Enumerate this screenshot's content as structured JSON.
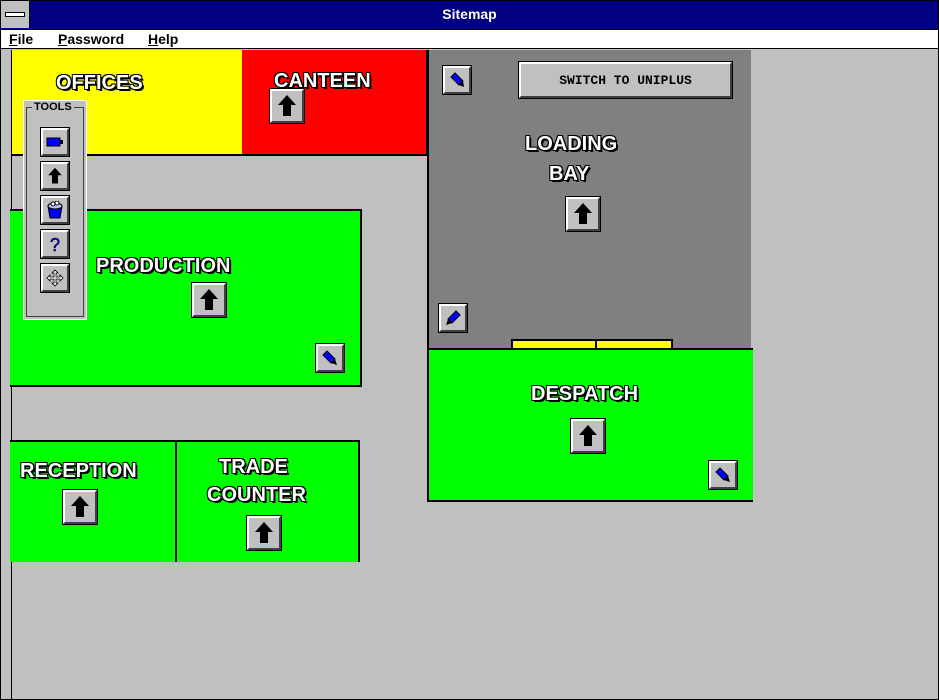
{
  "window": {
    "title": "Sitemap"
  },
  "menu": {
    "items": [
      "File",
      "Password",
      "Help"
    ]
  },
  "toolbox": {
    "title": "TOOLS"
  },
  "rooms": {
    "offices": "OFFICES",
    "canteen": "CANTEEN",
    "loading_bay_line1": "LOADING",
    "loading_bay_line2": "BAY",
    "production": "PRODUCTION",
    "despatch": "DESPATCH",
    "reception": "RECEPTION",
    "trade_counter_line1": "TRADE",
    "trade_counter_line2": "COUNTER"
  },
  "switch_button": {
    "label": "SWITCH TO UNIPLUS"
  },
  "icons": {
    "arrow": "up-arrow-icon",
    "pen": "pen-icon",
    "battery": "battery-icon",
    "bucket": "bucket-icon",
    "help": "question-mark-icon",
    "move": "move-icon"
  },
  "colors": {
    "title_bar": "#000080",
    "yellow_room": "#ffff00",
    "red_room": "#ff0000",
    "green_room": "#00ff00",
    "grey_room": "#808080",
    "background": "#c0c0c0"
  }
}
